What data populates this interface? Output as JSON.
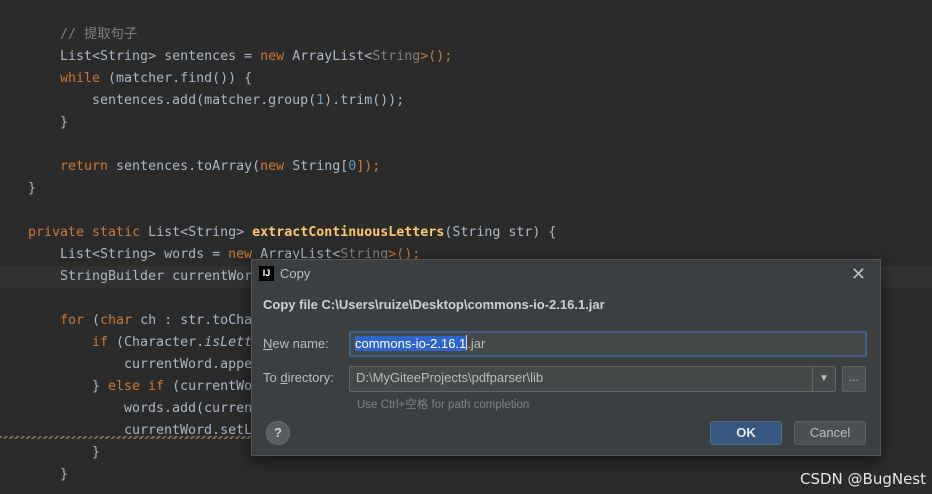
{
  "editor": {
    "comment": "// 提取句子",
    "l2": {
      "a": "List<",
      "b": "String",
      "c": "> sentences = ",
      "d": "new ",
      "e": "ArrayList<",
      "f": "String",
      "g": ">();"
    },
    "l3": {
      "a": "while ",
      "b": "(matcher.find()) {"
    },
    "l4": {
      "a": "sentences.add(matcher.group(",
      "b": "1",
      "c": ").trim());"
    },
    "l5": "}",
    "l6": {
      "a": "return ",
      "b": "sentences.toArray(",
      "c": "new ",
      "d": "String[",
      "e": "0",
      "f": "]);"
    },
    "l7": "}",
    "l8": {
      "a": "private static ",
      "b": "List<String> ",
      "c": "extractContinuousLetters",
      "d": "(String str) {"
    },
    "l9": {
      "a": "List<String> words = ",
      "b": "new ",
      "c": "ArrayList<",
      "d": "String",
      "e": ">();"
    },
    "l10": "StringBuilder currentWor",
    "l11": {
      "a": "for ",
      "b": "(",
      "c": "char ",
      "d": "ch : str.toCha"
    },
    "l12": {
      "a": "if ",
      "b": "(Character.",
      "c": "isLett"
    },
    "l13": "currentWord.appe",
    "l14": {
      "a": "} ",
      "b": "else if ",
      "c": "(currentWo"
    },
    "l15": "words.add(curren",
    "l16": "currentWord.setL",
    "l17": "}",
    "l18": "}"
  },
  "dialog": {
    "app_icon": "IJ",
    "title": "Copy",
    "heading": "Copy file C:\\Users\\ruize\\Desktop\\commons-io-2.16.1.jar",
    "new_name_label_mnemonic": "N",
    "new_name_label_rest": "ew name:",
    "new_name_selected": "commons-io-2.16.1",
    "new_name_rest": ".jar",
    "to_dir_label_pre": "To ",
    "to_dir_label_mnemonic": "d",
    "to_dir_label_rest": "irectory:",
    "directory_value": "D:\\MyGiteeProjects\\pdfparser\\lib",
    "browse_label": "...",
    "hint": "Use Ctrl+空格 for path completion",
    "help_label": "?",
    "ok_label": "OK",
    "cancel_label": "Cancel",
    "close_glyph": "✕",
    "arrow_glyph": "▼"
  },
  "watermark": "CSDN @BugNest"
}
